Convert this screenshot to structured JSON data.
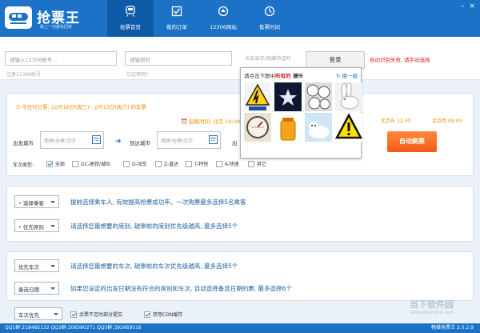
{
  "app": {
    "title": "抢票王",
    "subtitle": "踏上一切都有回家",
    "version": "畅推抢票王 2.0.2.9"
  },
  "nav": [
    {
      "label": "抢票首页",
      "icon": "train-icon",
      "active": true
    },
    {
      "label": "我的订单",
      "icon": "checklist-icon",
      "active": false
    },
    {
      "label": "12306网站",
      "icon": "globe-icon",
      "active": false
    },
    {
      "label": "售票时间",
      "icon": "clock-icon",
      "active": false
    }
  ],
  "login": {
    "account_placeholder": "请输入12306帐号...",
    "password_placeholder": "请输密码",
    "captcha_placeholder": "点击显示/隐藏验证码",
    "register_link": "注册12306帐号",
    "forgot_link": "忘记密码?",
    "login_button": "登录",
    "auto_message": "自动识别失败, 请手动选择"
  },
  "captcha": {
    "prompt_prefix": "请点击下图中",
    "prompt_highlight": "所有的",
    "prompt_word": "锤头",
    "refresh_label": "换一组",
    "tiles": [
      "warning-sign",
      "star-night",
      "clock-collage",
      "rabbit",
      "gauge",
      "oil-bottle",
      "seal-pup",
      "warning-triangle"
    ]
  },
  "booking": {
    "dates_text": "今日可订票: 12月16日(周三) - 2月13日(周六) 的车票",
    "clock_text": "起售时间: 北京 10:00",
    "times_text_1": "北京东 12:30",
    "times_text_2": "北京西 09:00",
    "from_label": "出发城市",
    "to_label": "到达城市",
    "date_label": "出",
    "from_placeholder": "简拼/全拼/汉字",
    "to_placeholder": "简拼/全拼/汉字",
    "auto_button": "自动刷票",
    "train_type_label": "车次类型:",
    "types": [
      {
        "label": "全部",
        "checked": true
      },
      {
        "label": "GC-高铁/城际",
        "checked": false
      },
      {
        "label": "D-动车",
        "checked": false
      },
      {
        "label": "Z-直达",
        "checked": false
      },
      {
        "label": "T-特快",
        "checked": false
      },
      {
        "label": "K-快速",
        "checked": false
      },
      {
        "label": "其它",
        "checked": false
      }
    ]
  },
  "options": {
    "passenger_select": "选择乘客",
    "passenger_desc": "提前选择乘车人, 有效提高抢票成功率。一次购票最多选择5名乘客",
    "seat_select": "优先席别",
    "seat_desc": "请选择您最想要的席别, 越靠前的席别优先级越高, 最多选择5个",
    "train_select": "优先车次",
    "train_desc": "请选择您最想要的车次, 越靠前的车次优先级越高, 最多选择5个",
    "date_select": "备选日期",
    "date_desc": "如果您设定的出发日期没有符合的席别和车次, 自动选择备选日期的票, 最多选择6个",
    "priority_select": "车次优先",
    "partial_submit": "余票不足时部分提交",
    "disable_cdn": "禁用CDN缓存"
  },
  "footer": {
    "qq": "QQ1群:218485132  QQ2群:206380271  QQ3群:392669516"
  },
  "watermark": {
    "name": "当下软件园",
    "url": "www.downxia.com"
  },
  "colors": {
    "brand": "#1b72c6",
    "accent": "#ff8a00",
    "danger": "#e02020"
  }
}
